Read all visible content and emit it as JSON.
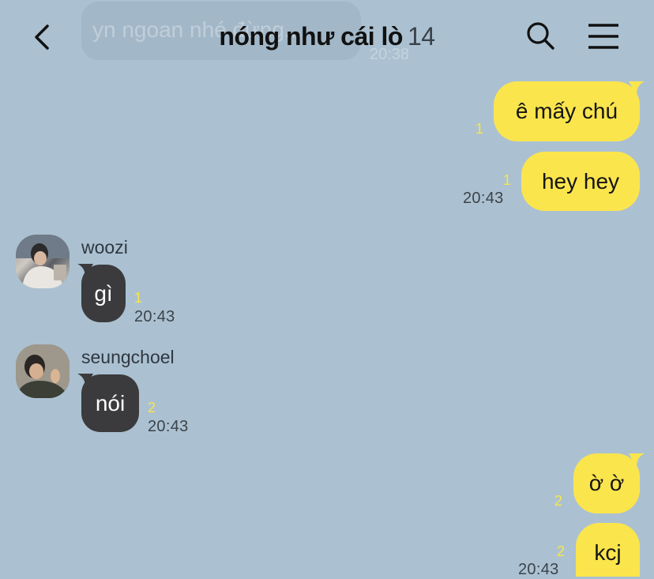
{
  "background_notice": {
    "text": "yn ngoan nhé đừng...",
    "time": "20:38"
  },
  "header": {
    "title": "nóng như cái lò",
    "member_count": "14"
  },
  "messages": [
    {
      "sender": "me",
      "text": "ê mấy chú",
      "unread": "1"
    },
    {
      "sender": "me",
      "text": "hey hey",
      "unread": "1",
      "time": "20:43"
    },
    {
      "sender": "woozi",
      "name": "woozi",
      "text": "gì",
      "unread": "1",
      "time": "20:43"
    },
    {
      "sender": "seungchoel",
      "name": "seungchoel",
      "text": "nói",
      "unread": "2",
      "time": "20:43"
    },
    {
      "sender": "me",
      "text": "ờ ờ",
      "unread": "2"
    },
    {
      "sender": "me",
      "text": "kcj",
      "unread": "2",
      "time": "20:43"
    }
  ],
  "colors": {
    "background": "#abc1d1",
    "my_bubble": "#fbe54d",
    "their_bubble": "#3b3b3d",
    "unread_count": "#f7e64b"
  },
  "icons": [
    "back-icon",
    "search-icon",
    "menu-icon"
  ]
}
